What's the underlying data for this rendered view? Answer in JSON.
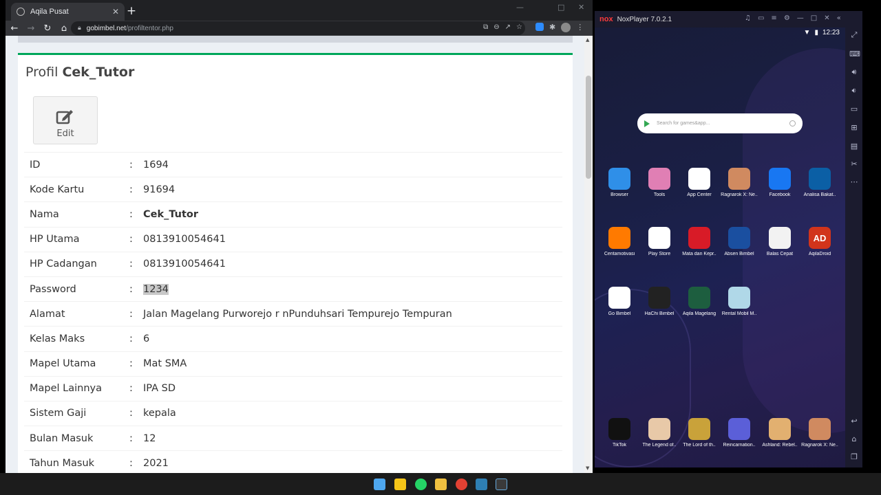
{
  "browser": {
    "tab_title": "Aqila Pusat",
    "tab_close": "✕",
    "new_tab": "+",
    "url_host": "gobimbel.net",
    "url_path": "/profiltentor.php"
  },
  "page": {
    "title_prefix": "Profil",
    "title_name": "Cek_Tutor",
    "edit_label": "Edit",
    "colon": ":",
    "rows": [
      {
        "key": "ID",
        "value": "1694"
      },
      {
        "key": "Kode Kartu",
        "value": "91694"
      },
      {
        "key": "Nama",
        "value": "Cek_Tutor"
      },
      {
        "key": "HP Utama",
        "value": "0813910054641"
      },
      {
        "key": "HP Cadangan",
        "value": "0813910054641"
      },
      {
        "key": "Password",
        "value": "1234"
      },
      {
        "key": "Alamat",
        "value": "Jalan Magelang Purworejo r nPunduhsari Tempurejo Tempuran"
      },
      {
        "key": "Kelas Maks",
        "value": "6"
      },
      {
        "key": "Mapel Utama",
        "value": "Mat SMA"
      },
      {
        "key": "Mapel Lainnya",
        "value": "IPA SD"
      },
      {
        "key": "Sistem Gaji",
        "value": "kepala"
      },
      {
        "key": "Bulan Masuk",
        "value": "12"
      },
      {
        "key": "Tahun Masuk",
        "value": "2021"
      }
    ]
  },
  "nox": {
    "logo": "nox",
    "title": "NoxPlayer 7.0.2.1",
    "time": "12:23",
    "search_placeholder": "Search for games&app...",
    "apps_row1": [
      "Browser",
      "Tools",
      "App Center",
      "Ragnarok X: Ne..",
      "Facebook",
      "Analisa Bakat.."
    ],
    "apps_row2": [
      "Ceritamotivasi",
      "Play Store",
      "Mata dan Kepr..",
      "Absen Bimbel",
      "Balas Cepat",
      "AqilaDroid"
    ],
    "apps_row3": [
      "Go Bimbel",
      "HaChi Bimbel",
      "Aqila Magelang",
      "Rental Mobil M.."
    ],
    "dock": [
      "TikTok",
      "The Legend of..",
      "The Lord of th..",
      "Reincarnation..",
      "Ashland: Rebel..",
      "Ragnarok X: Ne.."
    ],
    "ad_icon_text": "AD"
  },
  "colors": {
    "box_accent": "#00a65a",
    "chrome_dark": "#202124",
    "nox_bg": "#15152a"
  }
}
